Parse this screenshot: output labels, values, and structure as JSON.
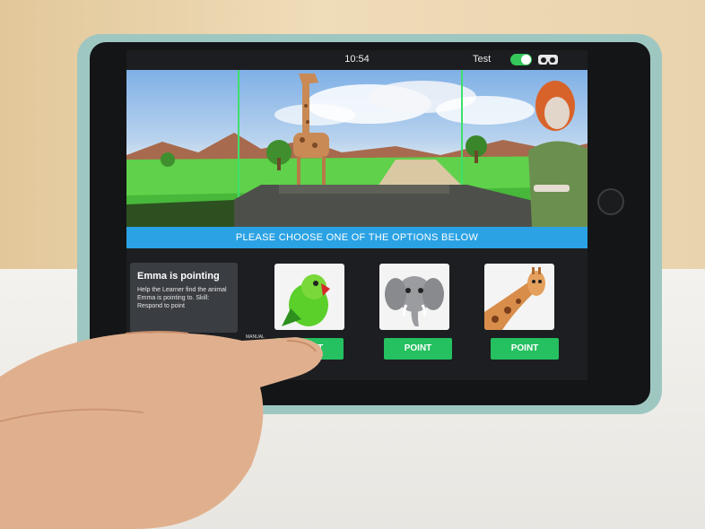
{
  "status_bar": {
    "time": "10:54",
    "profile": "Test",
    "vr_toggle_on": true,
    "vr_icon": "vr-headset-icon"
  },
  "scene": {
    "elements": [
      "giraffe",
      "tree",
      "road",
      "vehicle-hood",
      "emma-avatar"
    ]
  },
  "banner": {
    "text": "PLEASE CHOOSE ONE OF THE OPTIONS BELOW"
  },
  "instruction": {
    "title": "Emma is pointing",
    "body": "Help the Learner find the animal Emma is pointing to. Skill: Respond to point"
  },
  "manual_toggle": {
    "label": "MANUAL",
    "on": true
  },
  "options": [
    {
      "animal": "parrot",
      "button_label": "POINT"
    },
    {
      "animal": "elephant",
      "button_label": "POINT"
    },
    {
      "animal": "giraffe",
      "button_label": "POINT"
    }
  ],
  "colors": {
    "accent_blue": "#2aa2e4",
    "button_green": "#25c05f",
    "toggle_green": "#35c759",
    "case_teal": "#9fc7c2"
  }
}
